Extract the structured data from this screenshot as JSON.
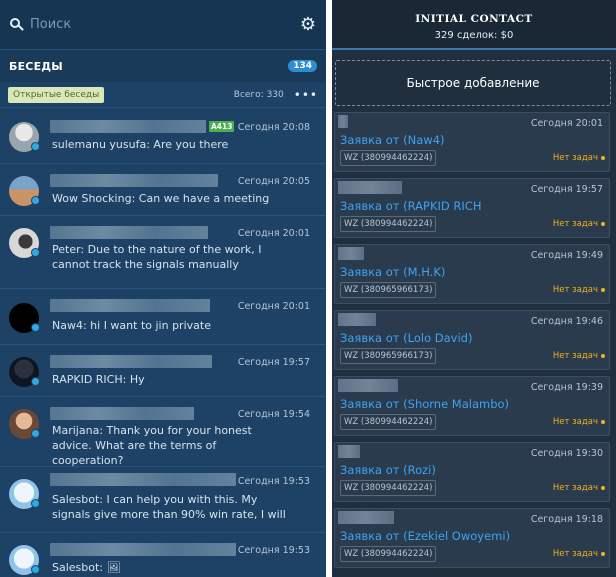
{
  "search": {
    "placeholder": "Поиск"
  },
  "sidebar": {
    "section_title": "БЕСЕДЫ",
    "count_badge": "134",
    "filter_label": "Открытые беседы",
    "total_label": "Всего: 330",
    "more": "•••"
  },
  "chats": [
    {
      "time": "Сегодня 20:08",
      "message": "sulemanu yusufa: Are you there",
      "tag": "A413"
    },
    {
      "time": "Сегодня 20:05",
      "message": "Wow Shocking: Can we have a meeting"
    },
    {
      "time": "Сегодня 20:01",
      "message": "Peter: Due to the nature of the work, I cannot track the signals manually"
    },
    {
      "time": "Сегодня 20:01",
      "message": "Naw4: hi I want to jin private"
    },
    {
      "time": "Сегодня 19:57",
      "message": "RAPKID RICH: Hy"
    },
    {
      "time": "Сегодня 19:54",
      "message": "Marijana: Thank you for your honest advice. What are the terms of cooperation?"
    },
    {
      "time": "Сегодня 19:53",
      "message": "Salesbot: I can help you with this. My signals give more than 90% win rate, I will"
    },
    {
      "time": "Сегодня 19:53",
      "message": "Salesbot: 🖼"
    }
  ],
  "pipeline": {
    "title": "INITIAL CONTACT",
    "subtitle": "329 сделок: $0",
    "quick_add": "Быстрое добавление"
  },
  "cards": [
    {
      "time": "Сегодня 20:01",
      "title": "Заявка от (Naw4)",
      "phone": "WZ (380994462224)",
      "status": "Нет задач"
    },
    {
      "time": "Сегодня 19:57",
      "title": "Заявка от (RAPKID RICH",
      "phone": "WZ (380994462224)",
      "status": "Нет задач"
    },
    {
      "time": "Сегодня 19:49",
      "title": "Заявка от (M.H.K)",
      "phone": "WZ (380965966173)",
      "status": "Нет задач"
    },
    {
      "time": "Сегодня 19:46",
      "title": "Заявка от (Lolo David)",
      "phone": "WZ (380965966173)",
      "status": "Нет задач"
    },
    {
      "time": "Сегодня 19:39",
      "title": "Заявка от (Shorne Malambo)",
      "phone": "WZ (380994462224)",
      "status": "Нет задач"
    },
    {
      "time": "Сегодня 19:30",
      "title": "Заявка от (Rozi)",
      "phone": "WZ (380994462224)",
      "status": "Нет задач"
    },
    {
      "time": "Сегодня 19:18",
      "title": "Заявка от (Ezekiel Owoyemi)",
      "phone": "WZ (380994462224)",
      "status": "Нет задач"
    }
  ],
  "colors": {
    "left_bg": "#1d4265",
    "right_bg": "#202f3d",
    "accent": "#3ea3f2",
    "status": "#f0b21d",
    "badge": "#2d8fd2"
  }
}
